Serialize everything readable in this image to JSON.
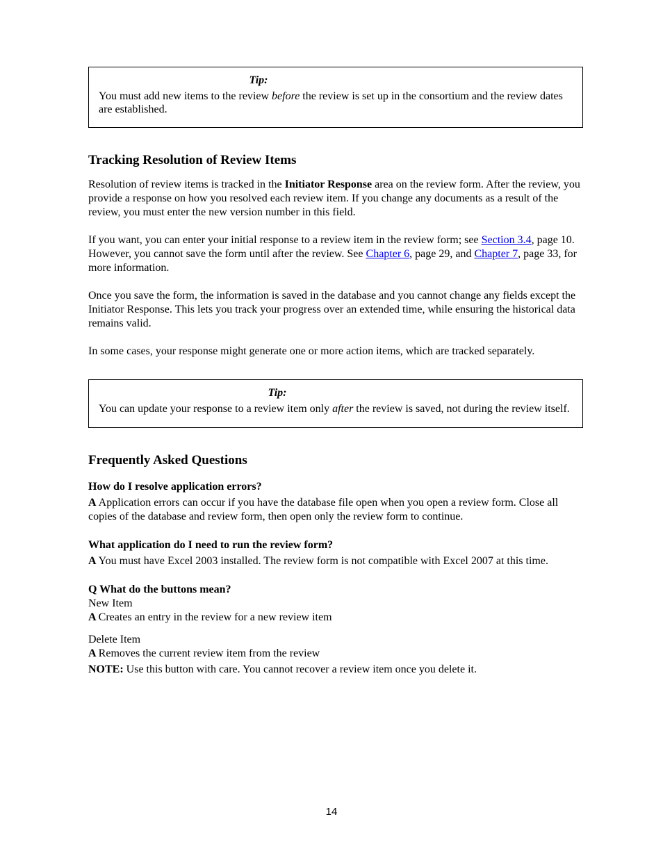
{
  "tip1": {
    "label": "Tip:",
    "text_before_italic": "You must add new items to the review ",
    "text_italic": "before",
    "text_after_italic": " the review is set up in the consortium and the review dates are established."
  },
  "section8": {
    "title": "Tracking Resolution of Review Items",
    "p1_before_bold": "Resolution of review items is tracked in the ",
    "p1_bold": "Initiator Response",
    "p1_after_bold": " area on the review form. After the review, you provide a response on how you resolved each review item. If you change any documents as a result of the review, you must enter the new version number in this field.",
    "p2_before_link1": "If you want, you can enter your initial response to a review item in the review form; see ",
    "p2_link1": "Section 3.4",
    "p2_after_link1": ", page 10. However, you cannot save the form until after the review. See ",
    "p2_link2": "Chapter 6",
    "p2_after_link2": ", page 29, and ",
    "p2_link3": "Chapter 7",
    "p2_after_link3": ", page 33, for more information.",
    "p3": "Once you save the form, the information is saved in the database and you cannot change any fields except the Initiator Response. This lets you track your progress over an extended time, while ensuring the historical data remains valid.",
    "p4": "In some cases, your response might generate one or more action items, which are tracked separately."
  },
  "tip2": {
    "label": "Tip:",
    "text_before_italic": "You can update your response to a review item only ",
    "text_italic": "after",
    "text_after_italic": " the review is saved, not during the review itself."
  },
  "section9": {
    "title": "Frequently Asked Questions",
    "q1": "How do I resolve application errors?",
    "a1_label": "A ",
    "a1_text": "Application errors can occur if you have the database file open when you open a review form. Close all copies of the database and review form, then open only the review form to continue.",
    "q2": "What application do I need to run the review form?",
    "a2_label": "A ",
    "a2_text": "You must have Excel 2003 installed. The review form is not compatible with Excel 2007 at this time.",
    "item1_q": "Q What do the buttons mean?",
    "item1_qtext": "New Item",
    "item1_a_label": "A ",
    "item1_a_text": "Creates an entry in the review for a new review item",
    "item2_qtext": "Delete Item",
    "item2_a_label": "A ",
    "item2_a_text": "Removes the current review item from the review",
    "note_bold": "NOTE: ",
    "note_text": "Use this button with care. You cannot recover a review item once you delete it."
  },
  "page_number": "14"
}
